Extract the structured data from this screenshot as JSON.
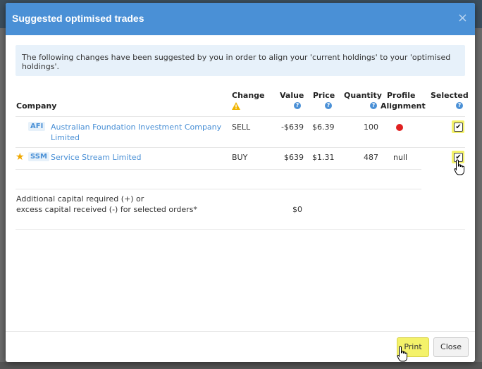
{
  "modal": {
    "title": "Suggested optimised trades",
    "close_glyph": "×",
    "info_text": "The following changes have been suggested by you in order to align your 'current holdings' to your 'optimised holdings'."
  },
  "table": {
    "headers": {
      "company": "Company",
      "change": "Change",
      "value": "Value",
      "price": "Price",
      "quantity": "Quantity",
      "profile": "Profile",
      "alignment": "Alignment",
      "selected": "Selected"
    },
    "rows": [
      {
        "ticker": "AFI",
        "name_line1": "Australian Foundation Investment Company",
        "name_line2": "Limited",
        "change": "SELL",
        "value": "-$639",
        "price": "$6.39",
        "quantity": "100",
        "alignment": "",
        "selected": true,
        "starred": false
      },
      {
        "ticker": "SSM",
        "name_line1": "Service Stream Limited",
        "name_line2": "",
        "change": "BUY",
        "value": "$639",
        "price": "$1.31",
        "quantity": "487",
        "alignment": "null",
        "selected": true,
        "starred": true
      }
    ],
    "capital_label_line1": "Additional capital required (+) or",
    "capital_label_line2": "excess capital received (-) for selected orders*",
    "capital_value": "$0"
  },
  "buttons": {
    "print": "Print",
    "close": "Close"
  },
  "icons": {
    "help": "?",
    "check": "✔",
    "star": "★",
    "cursor": "hand-pointer"
  },
  "colors": {
    "header_bg": "#4a90d6",
    "link": "#4a90d6",
    "highlight": "#f4f26a",
    "alert_dot": "#e02020",
    "star": "#f0a800"
  }
}
